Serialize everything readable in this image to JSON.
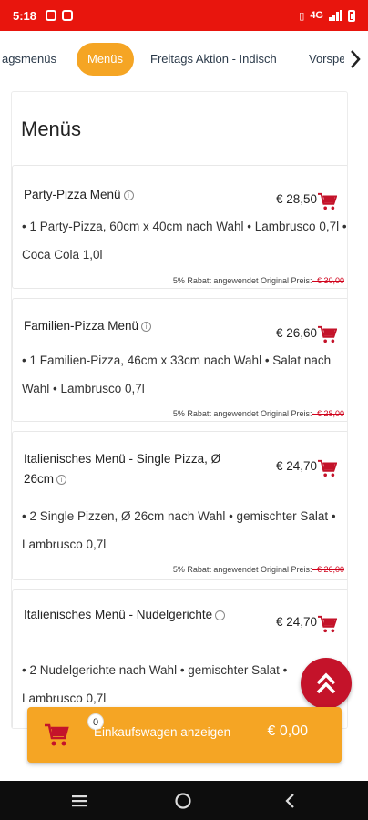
{
  "status_bar": {
    "time": "5:18",
    "network": "4G"
  },
  "tabs": [
    {
      "label": "agsmenüs",
      "active": false
    },
    {
      "label": "Menüs",
      "active": true
    },
    {
      "label": "Freitags Aktion - Indisch",
      "active": false
    },
    {
      "label": "Vorspe",
      "active": false
    }
  ],
  "section": {
    "title": "Menüs"
  },
  "items": [
    {
      "name": "Party-Pizza Menü",
      "price": "€ 28,50",
      "description": "• 1 Party-Pizza, 60cm x 40cm nach Wahl • Lambrusco 0,7l • Coca Cola 1,0l",
      "discount_text": "5% Rabatt angewendet Original Preis:",
      "original_price": "- € 30,00"
    },
    {
      "name": "Familien-Pizza Menü",
      "price": "€ 26,60",
      "description": "• 1 Familien-Pizza, 46cm x 33cm nach Wahl • Salat nach Wahl • Lambrusco 0,7l",
      "discount_text": "5% Rabatt angewendet Original Preis:",
      "original_price": "- € 28,00"
    },
    {
      "name": "Italienisches Menü - Single Pizza, Ø 26cm",
      "price": "€ 24,70",
      "description": "• 2 Single Pizzen, Ø 26cm nach Wahl • gemischter Salat • Lambrusco 0,7l",
      "discount_text": "5% Rabatt angewendet Original Preis:",
      "original_price": "- € 26,00"
    },
    {
      "name": "Italienisches Menü - Nudelgerichte",
      "price": "€ 24,70",
      "description": "• 2 Nudelgerichte nach Wahl • gemischter Salat • Lambrusco 0,7l"
    }
  ],
  "cart": {
    "count": "0",
    "label": "Einkaufswagen anzeigen",
    "total": "€ 0,00"
  },
  "colors": {
    "status_bar": "#e8150d",
    "accent": "#f5a524",
    "cart_icon": "#c4132a",
    "scroll_top": "#c4132a",
    "strike_price": "#d0021b"
  }
}
